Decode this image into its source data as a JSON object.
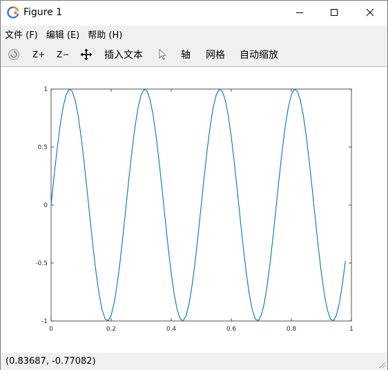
{
  "window": {
    "title": "Figure 1",
    "controls": {
      "minimize": "minimize-icon",
      "maximize": "maximize-icon",
      "close": "close-icon"
    }
  },
  "menu": {
    "items": [
      {
        "label": "文件 (F)"
      },
      {
        "label": "编辑 (E)"
      },
      {
        "label": "帮助 (H)"
      }
    ]
  },
  "toolbar": {
    "rotate_icon": "rotate-3d-icon",
    "zoom_in_label": "Z+",
    "zoom_out_label": "Z−",
    "pan_icon": "pan-move-icon",
    "insert_text_label": "插入文本",
    "select_icon": "pointer-select-icon",
    "axis_label": "轴",
    "grid_label": "网格",
    "autoscale_label": "自动缩放"
  },
  "status": {
    "coordinates": "(0.83687, -0.77082)"
  },
  "colors": {
    "line": "#0072bd",
    "axes": "#262626",
    "chrome": "#f0f0f0"
  },
  "chart_data": {
    "type": "line",
    "title": "",
    "xlabel": "",
    "ylabel": "",
    "function": "y = sin(8*pi*x)",
    "x_start": 0,
    "x_end": 0.98,
    "x_step": 0.01,
    "xlim": [
      0,
      1
    ],
    "ylim": [
      -1,
      1
    ],
    "x_ticks": [
      {
        "value": 0,
        "label": "0"
      },
      {
        "value": 0.2,
        "label": "0.2"
      },
      {
        "value": 0.4,
        "label": "0.4"
      },
      {
        "value": 0.6,
        "label": "0.6"
      },
      {
        "value": 0.8,
        "label": "0.8"
      },
      {
        "value": 1,
        "label": "1"
      }
    ],
    "y_ticks": [
      {
        "value": 1,
        "label": "1"
      },
      {
        "value": 0.5,
        "label": "0.5"
      },
      {
        "value": 0,
        "label": "0"
      },
      {
        "value": -0.5,
        "label": "-0.5"
      },
      {
        "value": -1,
        "label": "-1"
      }
    ],
    "grid": false,
    "box": true
  }
}
